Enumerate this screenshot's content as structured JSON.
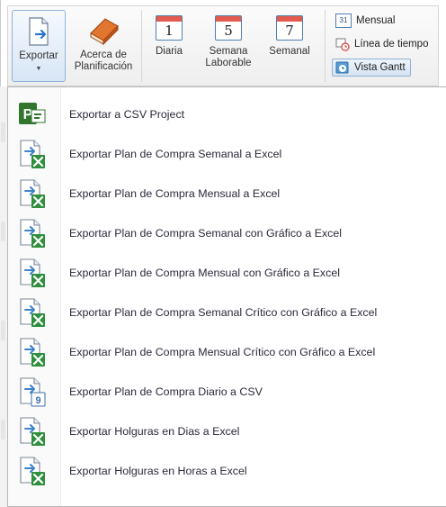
{
  "ribbon": {
    "export_label": "Exportar",
    "about_label_1": "Acerca de",
    "about_label_2": "Planificación",
    "daily_label": "Diaria",
    "daily_num": "1",
    "workweek_label_1": "Semana",
    "workweek_label_2": "Laborable",
    "workweek_num": "5",
    "weekly_label": "Semanal",
    "weekly_num": "7",
    "monthly_label": "Mensual",
    "monthly_num": "31",
    "timeline_label": "Línea de tiempo",
    "gantt_label": "Vista Gantt"
  },
  "menu": {
    "items": [
      {
        "label": "Exportar a CSV Project",
        "icon": "project-icon"
      },
      {
        "label": "Exportar Plan de Compra Semanal a Excel",
        "icon": "excel-doc-icon"
      },
      {
        "label": "Exportar Plan de Compra Mensual a Excel",
        "icon": "excel-doc-icon"
      },
      {
        "label": "Exportar Plan de Compra Semanal con Gráfico a Excel",
        "icon": "excel-doc-icon"
      },
      {
        "label": "Exportar Plan de Compra Mensual con Gráfico a Excel",
        "icon": "excel-doc-icon"
      },
      {
        "label": "Exportar Plan de Compra Semanal Crítico con Gráfico a Excel",
        "icon": "excel-doc-icon"
      },
      {
        "label": "Exportar Plan de Compra Mensual Crítico con Gráfico a Excel",
        "icon": "excel-doc-icon"
      },
      {
        "label": "Exportar Plan de Compra Diario a CSV",
        "icon": "csv-doc-icon"
      },
      {
        "label": "Exportar Holguras en Dias a Excel",
        "icon": "excel-doc-icon"
      },
      {
        "label": "Exportar Holguras en Horas a Excel",
        "icon": "excel-doc-icon"
      }
    ]
  },
  "colors": {
    "excel_green": "#2f8f3e",
    "calendar_red": "#e35b4e",
    "accent_blue": "#4f7fb0"
  }
}
